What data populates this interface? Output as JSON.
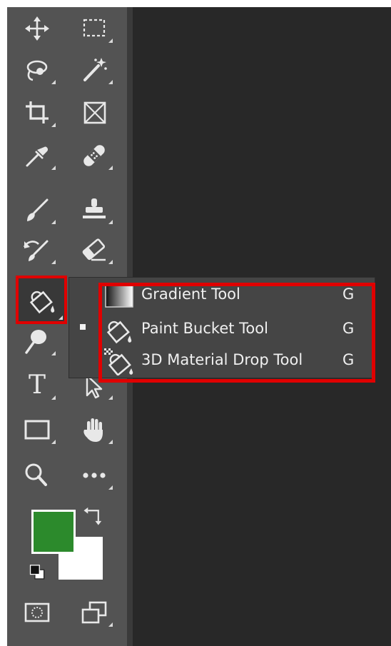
{
  "colors": {
    "toolbar_bg": "#535353",
    "canvas_bg": "#282828",
    "highlight": "#e00000",
    "foreground_color": "#2c8a2c",
    "background_color": "#ffffff"
  },
  "toolbar": {
    "tools": [
      {
        "name": "move-tool",
        "icon": "move-icon"
      },
      {
        "name": "marquee-tool",
        "icon": "rectangular-marquee-icon"
      },
      {
        "name": "lasso-tool",
        "icon": "lasso-icon"
      },
      {
        "name": "magic-wand-tool",
        "icon": "magic-wand-icon"
      },
      {
        "name": "crop-tool",
        "icon": "crop-icon"
      },
      {
        "name": "frame-tool",
        "icon": "frame-icon"
      },
      {
        "name": "eyedropper-tool",
        "icon": "eyedropper-icon"
      },
      {
        "name": "healing-brush-tool",
        "icon": "bandage-icon"
      },
      {
        "name": "brush-tool",
        "icon": "brush-icon"
      },
      {
        "name": "clone-stamp-tool",
        "icon": "stamp-icon"
      },
      {
        "name": "history-brush-tool",
        "icon": "history-brush-icon"
      },
      {
        "name": "eraser-tool",
        "icon": "eraser-icon"
      },
      {
        "name": "paint-bucket-tool",
        "icon": "paint-bucket-icon"
      },
      {
        "name": "dodge-tool",
        "icon": "dodge-icon"
      },
      {
        "name": "type-tool",
        "icon": "type-icon",
        "glyph": "T"
      },
      {
        "name": "path-selection-tool",
        "icon": "arrow-icon"
      },
      {
        "name": "rectangle-tool",
        "icon": "rectangle-icon"
      },
      {
        "name": "hand-tool",
        "icon": "hand-icon"
      },
      {
        "name": "zoom-tool",
        "icon": "zoom-icon"
      },
      {
        "name": "more-tools",
        "icon": "ellipsis-icon"
      },
      {
        "name": "quick-mask",
        "icon": "quick-mask-icon"
      },
      {
        "name": "screen-mode",
        "icon": "screen-mode-icon"
      }
    ]
  },
  "flyout": {
    "items": [
      {
        "label": "Gradient Tool",
        "shortcut": "G",
        "icon": "gradient-icon"
      },
      {
        "label": "Paint Bucket Tool",
        "shortcut": "G",
        "icon": "paint-bucket-icon",
        "selected": true
      },
      {
        "label": "3D Material Drop Tool",
        "shortcut": "G",
        "icon": "3d-material-drop-icon"
      }
    ]
  }
}
